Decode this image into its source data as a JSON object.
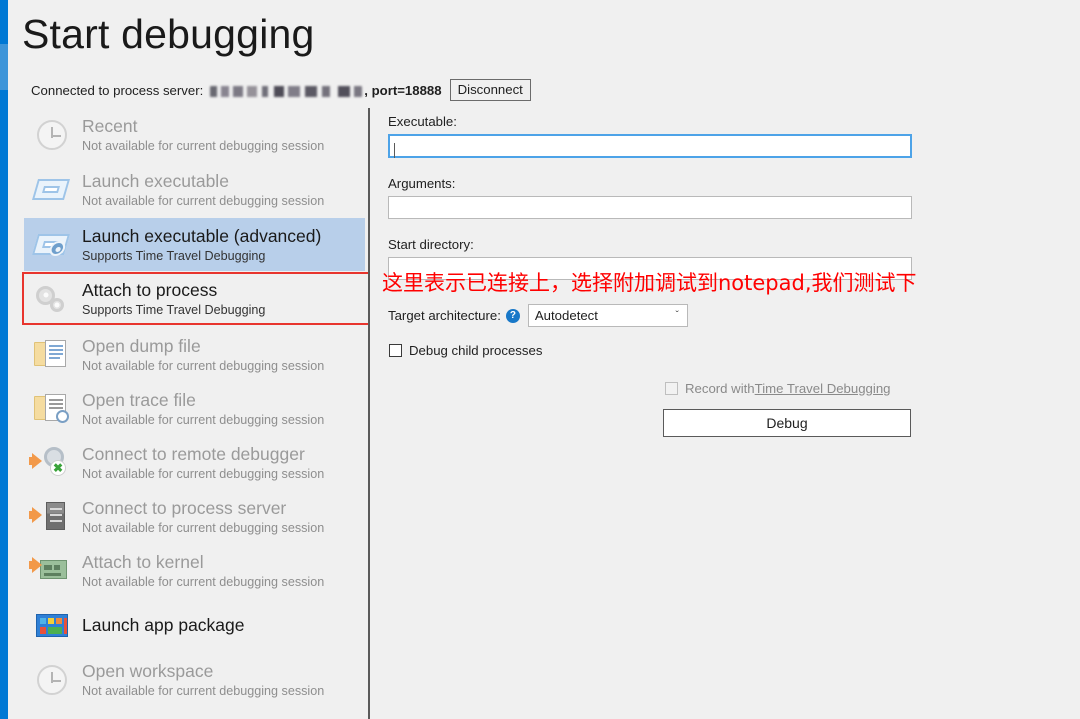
{
  "page": {
    "title": "Start debugging"
  },
  "connection": {
    "label": "Connected to process server:",
    "server_name_redacted": true,
    "port_text": ", port=18888",
    "disconnect_label": "Disconnect"
  },
  "sidebar": {
    "items": [
      {
        "icon": "clock-icon",
        "title": "Recent",
        "subtitle": "Not available for current debugging session",
        "enabled": false,
        "selected": false,
        "boxed": false
      },
      {
        "icon": "launch-executable-icon",
        "title": "Launch executable",
        "subtitle": "Not available for current debugging session",
        "enabled": false,
        "selected": false,
        "boxed": false
      },
      {
        "icon": "launch-executable-advanced-icon",
        "title": "Launch executable (advanced)",
        "subtitle": "Supports Time Travel Debugging",
        "enabled": true,
        "selected": true,
        "boxed": false
      },
      {
        "icon": "gears-icon",
        "title": "Attach to process",
        "subtitle": "Supports Time Travel Debugging",
        "enabled": true,
        "selected": false,
        "boxed": true
      },
      {
        "icon": "open-dump-file-icon",
        "title": "Open dump file",
        "subtitle": "Not available for current debugging session",
        "enabled": false,
        "selected": false,
        "boxed": false
      },
      {
        "icon": "open-trace-file-icon",
        "title": "Open trace file",
        "subtitle": "Not available for current debugging session",
        "enabled": false,
        "selected": false,
        "boxed": false
      },
      {
        "icon": "connect-remote-debugger-icon",
        "title": "Connect to remote debugger",
        "subtitle": "Not available for current debugging session",
        "enabled": false,
        "selected": false,
        "boxed": false
      },
      {
        "icon": "connect-process-server-icon",
        "title": "Connect to process server",
        "subtitle": "Not available for current debugging session",
        "enabled": false,
        "selected": false,
        "boxed": false
      },
      {
        "icon": "attach-to-kernel-icon",
        "title": "Attach to kernel",
        "subtitle": "Not available for current debugging session",
        "enabled": false,
        "selected": false,
        "boxed": false
      },
      {
        "icon": "launch-app-package-icon",
        "title": "Launch app package",
        "subtitle": "",
        "enabled": true,
        "selected": false,
        "boxed": false
      },
      {
        "icon": "clock-icon",
        "title": "Open workspace",
        "subtitle": "Not available for current debugging session",
        "enabled": false,
        "selected": false,
        "boxed": false
      }
    ]
  },
  "form": {
    "executable_label": "Executable:",
    "executable_value": "",
    "arguments_label": "Arguments:",
    "arguments_value": "",
    "start_directory_label": "Start directory:",
    "start_directory_value": "",
    "target_architecture_label": "Target architecture:",
    "help_icon_glyph": "?",
    "target_architecture_value": "Autodetect",
    "chevron_glyph": "ˇ",
    "debug_child_processes_label": "Debug child processes",
    "debug_child_processes_checked": false,
    "record_ttd_prefix": "Record with ",
    "record_ttd_link": "Time Travel Debugging",
    "record_ttd_checked": false,
    "debug_button_label": "Debug"
  },
  "annotation": {
    "text": "这里表示已连接上，选择附加调试到notepad,我们测试下",
    "color": "#ff0000"
  },
  "colors": {
    "accent_blue": "#0078d4",
    "accent_blue_light": "#3e95d9",
    "selection_blue": "#b8cfea",
    "annotation_red": "#e8352e",
    "page_background": "#f0f0f0"
  }
}
